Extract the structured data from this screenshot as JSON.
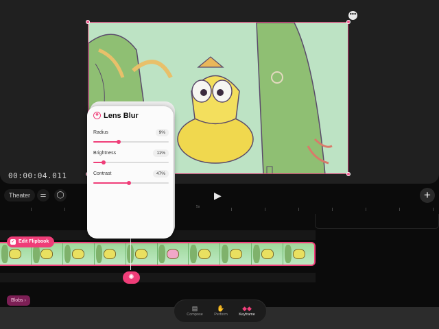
{
  "preview": {
    "timecode": "00:00:04.011",
    "more_label": "•••"
  },
  "toolbar": {
    "theater_label": "Theater",
    "adjust_icon": "sliders-icon",
    "comment_icon": "speech-bubble-icon",
    "play_label": "▶",
    "add_label": "+"
  },
  "ruler": {
    "marker_label": "5s"
  },
  "lens_blur": {
    "title": "Lens Blur",
    "icon": "lens-aperture-icon",
    "params": [
      {
        "label": "Radius",
        "value": "9%",
        "fraction": 0.34
      },
      {
        "label": "Brightness",
        "value": "11%",
        "fraction": 0.14
      },
      {
        "label": "Contrast",
        "value": "47%",
        "fraction": 0.47
      }
    ]
  },
  "track": {
    "flipbook_label": "Edit Flipbook",
    "blobs_label": "Blobs ›",
    "lens_node_icon": "lens-aperture-icon"
  },
  "bottom_nav": {
    "items": [
      {
        "label": "Compose",
        "icon": "layers-icon"
      },
      {
        "label": "Perform",
        "icon": "hand-icon"
      },
      {
        "label": "Keyframe",
        "icon": "keyframe-icon"
      }
    ],
    "active": "Keyframe"
  },
  "colors": {
    "accent": "#ef3d78",
    "canvas_bg": "#b9e0bf",
    "panel": "#202020"
  }
}
